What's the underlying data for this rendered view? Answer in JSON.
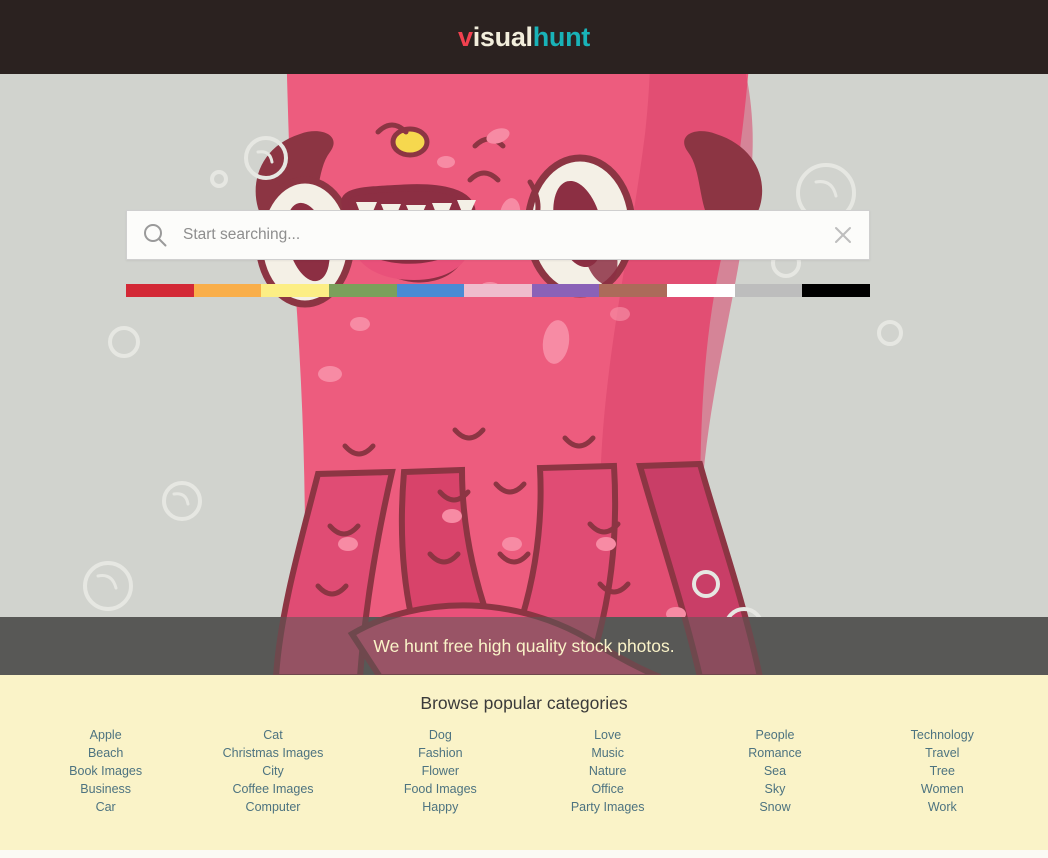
{
  "header": {
    "logo": {
      "part1": "v",
      "part2": "isual",
      "part3": "hunt"
    }
  },
  "search": {
    "placeholder": "Start searching...",
    "value": "",
    "search_icon": "search-icon",
    "clear_icon": "close-icon",
    "color_filters": [
      {
        "name": "red",
        "hex": "#D32836"
      },
      {
        "name": "orange",
        "hex": "#F9AE4A"
      },
      {
        "name": "yellow",
        "hex": "#FCEE85"
      },
      {
        "name": "green",
        "hex": "#7BA05B"
      },
      {
        "name": "blue",
        "hex": "#4A8BD4"
      },
      {
        "name": "pink",
        "hex": "#EFBCCD"
      },
      {
        "name": "purple",
        "hex": "#8A62B8"
      },
      {
        "name": "brown",
        "hex": "#AC6B5A"
      },
      {
        "name": "white",
        "hex": "#FFFFFF"
      },
      {
        "name": "gray",
        "hex": "#BDBDBD"
      },
      {
        "name": "black",
        "hex": "#000000"
      }
    ]
  },
  "banner": {
    "tagline": "We hunt free high quality stock photos."
  },
  "categories": {
    "title": "Browse popular categories",
    "columns": [
      {
        "items": [
          "Apple",
          "Beach",
          "Book Images",
          "Business",
          "Car"
        ]
      },
      {
        "items": [
          "Cat",
          "Christmas Images",
          "City",
          "Coffee Images",
          "Computer"
        ]
      },
      {
        "items": [
          "Dog",
          "Fashion",
          "Flower",
          "Food Images",
          "Happy"
        ]
      },
      {
        "items": [
          "Love",
          "Music",
          "Nature",
          "Office",
          "Party Images"
        ]
      },
      {
        "items": [
          "People",
          "Romance",
          "Sea",
          "Sky",
          "Snow"
        ]
      },
      {
        "items": [
          "Technology",
          "Travel",
          "Tree",
          "Women",
          "Work"
        ]
      }
    ]
  },
  "theme": {
    "header_bg": "#2B2220",
    "hero_bg": "#D1D3CE",
    "banner_bg": "#3C3C3C",
    "categories_bg": "#FAF3C8",
    "link_color": "#4D7380",
    "logo_accent": "#F1414F",
    "logo_accent2": "#19B3B8"
  }
}
